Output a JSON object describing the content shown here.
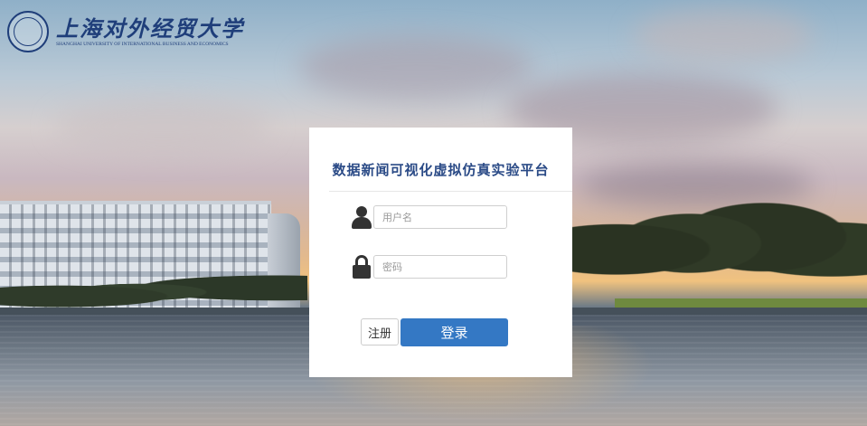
{
  "university": {
    "name_cn": "上海对外经贸大学",
    "name_en": "SHANGHAI UNIVERSITY OF INTERNATIONAL BUSINESS AND ECONOMICS"
  },
  "login": {
    "title": "数据新闻可视化虚拟仿真实验平台",
    "username_placeholder": "用户名",
    "password_placeholder": "密码",
    "register_label": "注册",
    "login_label": "登录"
  },
  "colors": {
    "accent": "#3478c4",
    "title": "#2a4a86",
    "logo": "#1f3e7a"
  },
  "icons": {
    "username": "user-icon",
    "password": "lock-icon",
    "seal": "university-seal-icon"
  }
}
